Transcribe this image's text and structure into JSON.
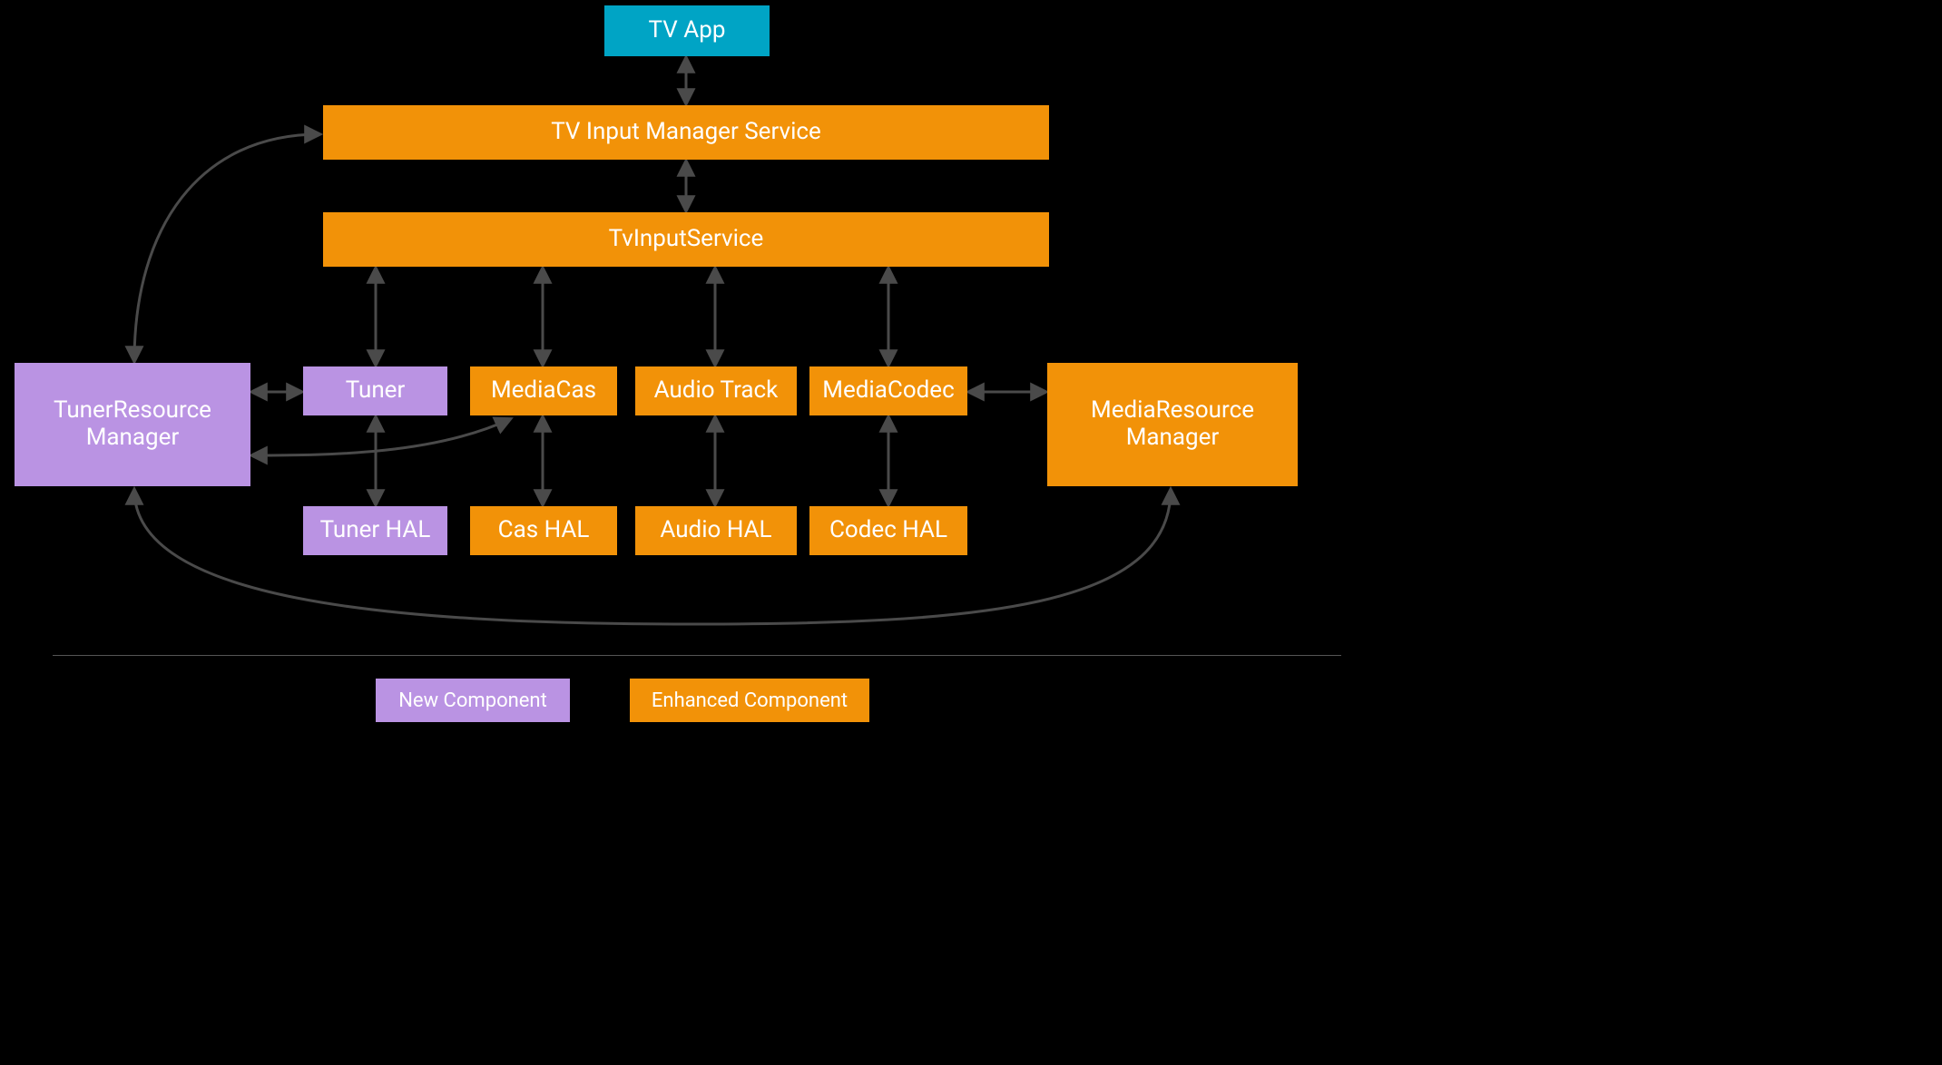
{
  "nodes": {
    "tv_app": "TV App",
    "tims": "TV Input Manager Service",
    "tis": "TvInputService",
    "trm": "TunerResource\nManager",
    "tuner": "Tuner",
    "mediacas": "MediaCas",
    "audiotrack": "Audio Track",
    "mediacodec": "MediaCodec",
    "mrm": "MediaResource\nManager",
    "tuner_hal": "Tuner HAL",
    "cas_hal": "Cas HAL",
    "audio_hal": "Audio HAL",
    "codec_hal": "Codec HAL"
  },
  "legend": {
    "new": "New Component",
    "enhanced": "Enhanced Component"
  },
  "colors": {
    "orange": "#f29208",
    "blue": "#00a4c5",
    "purple": "#ba93e3",
    "arrow": "#4a4a4a"
  },
  "semantics": {
    "purple_nodes": [
      "TunerResourceManager",
      "Tuner",
      "Tuner HAL"
    ],
    "orange_nodes": [
      "TV Input Manager Service",
      "TvInputService",
      "MediaCas",
      "Audio Track",
      "MediaCodec",
      "MediaResourceManager",
      "Cas HAL",
      "Audio HAL",
      "Codec HAL"
    ],
    "blue_nodes": [
      "TV App"
    ],
    "arrows_bidirectional": [
      [
        "TV App",
        "TV Input Manager Service"
      ],
      [
        "TV Input Manager Service",
        "TvInputService"
      ],
      [
        "TvInputService",
        "Tuner"
      ],
      [
        "TvInputService",
        "MediaCas"
      ],
      [
        "TvInputService",
        "Audio Track"
      ],
      [
        "TvInputService",
        "MediaCodec"
      ],
      [
        "Tuner",
        "Tuner HAL"
      ],
      [
        "MediaCas",
        "Cas HAL"
      ],
      [
        "Audio Track",
        "Audio HAL"
      ],
      [
        "MediaCodec",
        "Codec HAL"
      ],
      [
        "TunerResourceManager",
        "Tuner"
      ],
      [
        "MediaCodec",
        "MediaResourceManager"
      ],
      [
        "TunerResourceManager",
        "MediaResourceManager"
      ],
      [
        "TunerResourceManager",
        "TV Input Manager Service"
      ],
      [
        "TunerResourceManager",
        "MediaCas"
      ]
    ]
  }
}
